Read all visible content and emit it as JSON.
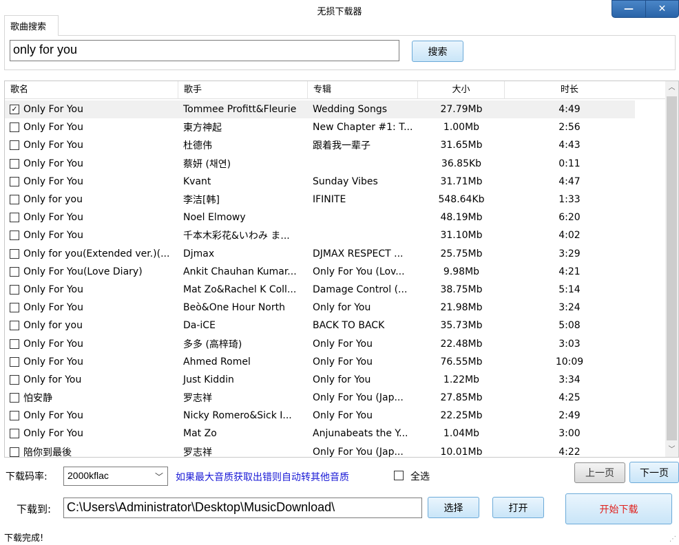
{
  "window": {
    "title": "无损下载器",
    "min_glyph": "—",
    "close_glyph": "✕"
  },
  "tab": {
    "label": "歌曲搜索"
  },
  "search": {
    "value": "only for you",
    "button_label": "搜索"
  },
  "table": {
    "headers": {
      "name": "歌名",
      "artist": "歌手",
      "album": "专辑",
      "size": "大小",
      "duration": "时长"
    },
    "rows": [
      {
        "checked": true,
        "name": "Only For You",
        "artist": "Tommee Profitt&Fleurie",
        "album": "Wedding Songs",
        "size": "27.79Mb",
        "duration": "4:49"
      },
      {
        "checked": false,
        "name": "Only For You",
        "artist": "東方神起",
        "album": "New Chapter #1: T...",
        "size": "1.00Mb",
        "duration": "2:56"
      },
      {
        "checked": false,
        "name": "Only For You",
        "artist": "杜德伟",
        "album": "跟着我一辈子",
        "size": "31.65Mb",
        "duration": "4:43"
      },
      {
        "checked": false,
        "name": "Only For You",
        "artist": "蔡妍 (채연)",
        "album": "",
        "size": "36.85Kb",
        "duration": "0:11"
      },
      {
        "checked": false,
        "name": "Only For You",
        "artist": "Kvant",
        "album": "Sunday Vibes",
        "size": "31.71Mb",
        "duration": "4:47"
      },
      {
        "checked": false,
        "name": "Only for you",
        "artist": "李洁[韩]",
        "album": "IFINITE",
        "size": "548.64Kb",
        "duration": "1:33"
      },
      {
        "checked": false,
        "name": "Only For You",
        "artist": "Noel Elmowy",
        "album": "",
        "size": "48.19Mb",
        "duration": "6:20"
      },
      {
        "checked": false,
        "name": "Only For You",
        "artist": "千本木彩花&いわみ ま...",
        "album": "",
        "size": "31.10Mb",
        "duration": "4:02"
      },
      {
        "checked": false,
        "name": "Only for you(Extended ver.)(...",
        "artist": "Djmax",
        "album": "DJMAX RESPECT ...",
        "size": "25.75Mb",
        "duration": "3:29"
      },
      {
        "checked": false,
        "name": "Only For You(Love Diary)",
        "artist": "Ankit Chauhan Kumar...",
        "album": "Only For You (Lov...",
        "size": "9.98Mb",
        "duration": "4:21"
      },
      {
        "checked": false,
        "name": "Only For You",
        "artist": "Mat Zo&Rachel K Coll...",
        "album": "Damage Control (...",
        "size": "38.75Mb",
        "duration": "5:14"
      },
      {
        "checked": false,
        "name": "Only For You",
        "artist": "Beò&One Hour North",
        "album": "Only for You",
        "size": "21.98Mb",
        "duration": "3:24"
      },
      {
        "checked": false,
        "name": "Only for you",
        "artist": "Da-iCE",
        "album": "BACK TO BACK",
        "size": "35.73Mb",
        "duration": "5:08"
      },
      {
        "checked": false,
        "name": "Only For You",
        "artist": "多多 (高梓琦)",
        "album": "Only For You",
        "size": "22.48Mb",
        "duration": "3:03"
      },
      {
        "checked": false,
        "name": "Only For You",
        "artist": "Ahmed Romel",
        "album": "Only For You",
        "size": "76.55Mb",
        "duration": "10:09"
      },
      {
        "checked": false,
        "name": "Only for You",
        "artist": "Just Kiddin",
        "album": "Only for You",
        "size": "1.22Mb",
        "duration": "3:34"
      },
      {
        "checked": false,
        "name": "怕安静",
        "artist": "罗志祥",
        "album": "Only For You (Jap...",
        "size": "27.85Mb",
        "duration": "4:25"
      },
      {
        "checked": false,
        "name": "Only For You",
        "artist": "Nicky Romero&Sick I...",
        "album": "Only For You",
        "size": "22.25Mb",
        "duration": "2:49"
      },
      {
        "checked": false,
        "name": "Only For You",
        "artist": "Mat Zo",
        "album": "Anjunabeats the Y...",
        "size": "1.04Mb",
        "duration": "3:00"
      },
      {
        "checked": false,
        "name": "陪你到最後",
        "artist": "罗志祥",
        "album": "Only For You (Jap...",
        "size": "10.01Mb",
        "duration": "4:22"
      }
    ]
  },
  "bitrate": {
    "label": "下载码率:",
    "value": "2000kflac",
    "hint": "如果最大音质获取出错则自动转其他音质"
  },
  "select_all": {
    "label": "全选",
    "checked": false
  },
  "paging": {
    "prev_label": "上一页",
    "next_label": "下一页"
  },
  "path": {
    "label": "下载到:",
    "value": "C:\\Users\\Administrator\\Desktop\\MusicDownload\\",
    "choose_label": "选择",
    "open_label": "打开"
  },
  "start_label": "开始下载",
  "status_text": "下载完成!",
  "colors": {
    "accent": "#2a64a8",
    "start_text": "#e0201c",
    "hint_text": "#1a1ad6"
  }
}
